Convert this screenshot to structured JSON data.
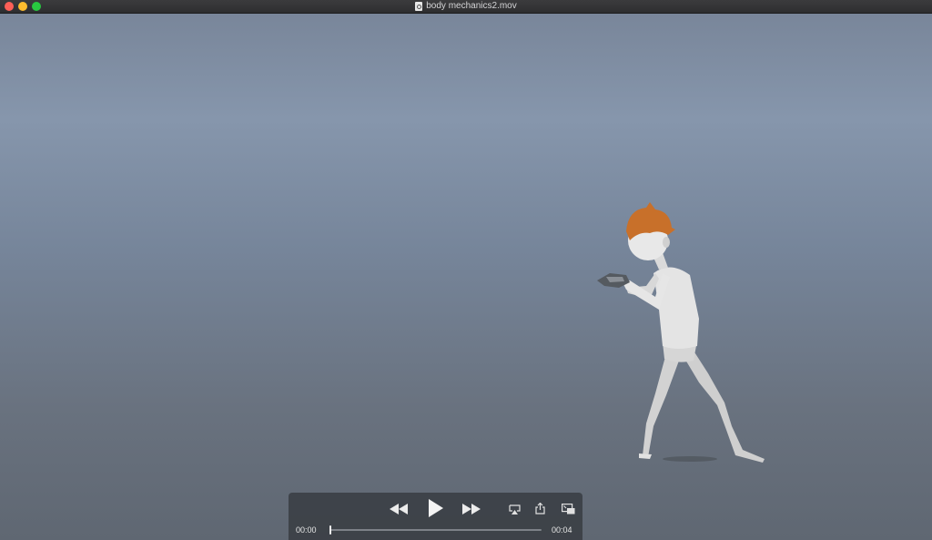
{
  "window": {
    "title": "body mechanics2.mov"
  },
  "player": {
    "current_time": "00:00",
    "duration": "00:04",
    "progress_fraction": 0.0,
    "buttons": {
      "rewind": "rewind-icon",
      "play": "play-icon",
      "fast_forward": "fast-forward-icon",
      "airplay": "airplay-icon",
      "share": "share-icon",
      "picture_in_picture": "picture-in-picture-icon"
    }
  },
  "colors": {
    "hair": "#c8702a",
    "skin": "#dcdcdc",
    "controls_bg": "#34383e"
  }
}
